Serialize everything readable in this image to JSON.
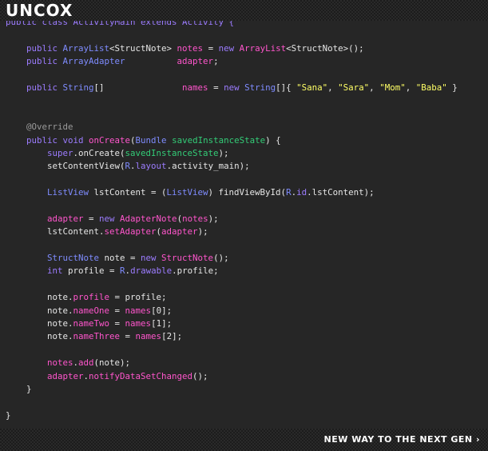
{
  "header": {
    "logo": "UNCOX"
  },
  "footer": {
    "tagline": "NEW WAY TO THE NEXT GEN ›"
  },
  "theme": {
    "plain": "#e6e6e6",
    "keyword": "#9c7cff",
    "type": "#7f8cff",
    "method": "#ff55cc",
    "variable": "#ff55cc",
    "string": "#ffff66",
    "param": "#33cc77",
    "annotation": "#9a9a9a",
    "field": "#9c7cff"
  },
  "code_lines": [
    [
      {
        "t": "public class ActivityMain extends Activity {",
        "c": "keyword"
      }
    ],
    [],
    [
      {
        "t": "    public ",
        "c": "keyword"
      },
      {
        "t": "ArrayList",
        "c": "type"
      },
      {
        "t": "<StructNote> ",
        "c": "plain"
      },
      {
        "t": "notes",
        "c": "variable"
      },
      {
        "t": " = ",
        "c": "plain"
      },
      {
        "t": "new ",
        "c": "keyword"
      },
      {
        "t": "ArrayList",
        "c": "method"
      },
      {
        "t": "<StructNote>();",
        "c": "plain"
      }
    ],
    [
      {
        "t": "    public ",
        "c": "keyword"
      },
      {
        "t": "ArrayAdapter",
        "c": "type"
      },
      {
        "t": "          ",
        "c": "plain"
      },
      {
        "t": "adapter",
        "c": "variable"
      },
      {
        "t": ";",
        "c": "plain"
      }
    ],
    [],
    [
      {
        "t": "    public ",
        "c": "keyword"
      },
      {
        "t": "String",
        "c": "type"
      },
      {
        "t": "[]               ",
        "c": "plain"
      },
      {
        "t": "names",
        "c": "variable"
      },
      {
        "t": " = ",
        "c": "plain"
      },
      {
        "t": "new ",
        "c": "keyword"
      },
      {
        "t": "String",
        "c": "type"
      },
      {
        "t": "[]{ ",
        "c": "plain"
      },
      {
        "t": "\"Sana\"",
        "c": "string"
      },
      {
        "t": ", ",
        "c": "plain"
      },
      {
        "t": "\"Sara\"",
        "c": "string"
      },
      {
        "t": ", ",
        "c": "plain"
      },
      {
        "t": "\"Mom\"",
        "c": "string"
      },
      {
        "t": ", ",
        "c": "plain"
      },
      {
        "t": "\"Baba\"",
        "c": "string"
      },
      {
        "t": " }",
        "c": "plain"
      }
    ],
    [],
    [],
    [
      {
        "t": "    @Override",
        "c": "annotation"
      }
    ],
    [
      {
        "t": "    public void ",
        "c": "keyword"
      },
      {
        "t": "onCreate",
        "c": "method"
      },
      {
        "t": "(",
        "c": "plain"
      },
      {
        "t": "Bundle ",
        "c": "type"
      },
      {
        "t": "savedInstanceState",
        "c": "param"
      },
      {
        "t": ") {",
        "c": "plain"
      }
    ],
    [
      {
        "t": "        super",
        "c": "keyword"
      },
      {
        "t": ".onCreate(",
        "c": "plain"
      },
      {
        "t": "savedInstanceState",
        "c": "param"
      },
      {
        "t": ");",
        "c": "plain"
      }
    ],
    [
      {
        "t": "        setContentView(",
        "c": "plain"
      },
      {
        "t": "R",
        "c": "type"
      },
      {
        "t": ".",
        "c": "plain"
      },
      {
        "t": "layout",
        "c": "field"
      },
      {
        "t": ".activity_main);",
        "c": "plain"
      }
    ],
    [],
    [
      {
        "t": "        ListView ",
        "c": "type"
      },
      {
        "t": "lstContent = (",
        "c": "plain"
      },
      {
        "t": "ListView",
        "c": "type"
      },
      {
        "t": ") findViewById(",
        "c": "plain"
      },
      {
        "t": "R",
        "c": "type"
      },
      {
        "t": ".",
        "c": "plain"
      },
      {
        "t": "id",
        "c": "field"
      },
      {
        "t": ".lstContent);",
        "c": "plain"
      }
    ],
    [],
    [
      {
        "t": "        adapter",
        "c": "variable"
      },
      {
        "t": " = ",
        "c": "plain"
      },
      {
        "t": "new ",
        "c": "keyword"
      },
      {
        "t": "AdapterNote",
        "c": "method"
      },
      {
        "t": "(",
        "c": "plain"
      },
      {
        "t": "notes",
        "c": "variable"
      },
      {
        "t": ");",
        "c": "plain"
      }
    ],
    [
      {
        "t": "        lstContent.",
        "c": "plain"
      },
      {
        "t": "setAdapter",
        "c": "method"
      },
      {
        "t": "(",
        "c": "plain"
      },
      {
        "t": "adapter",
        "c": "variable"
      },
      {
        "t": ");",
        "c": "plain"
      }
    ],
    [],
    [
      {
        "t": "        StructNote ",
        "c": "type"
      },
      {
        "t": "note = ",
        "c": "plain"
      },
      {
        "t": "new ",
        "c": "keyword"
      },
      {
        "t": "StructNote",
        "c": "method"
      },
      {
        "t": "();",
        "c": "plain"
      }
    ],
    [
      {
        "t": "        int ",
        "c": "keyword"
      },
      {
        "t": "profile = ",
        "c": "plain"
      },
      {
        "t": "R",
        "c": "type"
      },
      {
        "t": ".",
        "c": "plain"
      },
      {
        "t": "drawable",
        "c": "field"
      },
      {
        "t": ".profile;",
        "c": "plain"
      }
    ],
    [],
    [
      {
        "t": "        note.",
        "c": "plain"
      },
      {
        "t": "profile",
        "c": "variable"
      },
      {
        "t": " = profile;",
        "c": "plain"
      }
    ],
    [
      {
        "t": "        note.",
        "c": "plain"
      },
      {
        "t": "nameOne",
        "c": "variable"
      },
      {
        "t": " = ",
        "c": "plain"
      },
      {
        "t": "names",
        "c": "variable"
      },
      {
        "t": "[0];",
        "c": "plain"
      }
    ],
    [
      {
        "t": "        note.",
        "c": "plain"
      },
      {
        "t": "nameTwo",
        "c": "variable"
      },
      {
        "t": " = ",
        "c": "plain"
      },
      {
        "t": "names",
        "c": "variable"
      },
      {
        "t": "[1];",
        "c": "plain"
      }
    ],
    [
      {
        "t": "        note.",
        "c": "plain"
      },
      {
        "t": "nameThree",
        "c": "variable"
      },
      {
        "t": " = ",
        "c": "plain"
      },
      {
        "t": "names",
        "c": "variable"
      },
      {
        "t": "[2];",
        "c": "plain"
      }
    ],
    [],
    [
      {
        "t": "        notes",
        "c": "variable"
      },
      {
        "t": ".",
        "c": "plain"
      },
      {
        "t": "add",
        "c": "method"
      },
      {
        "t": "(note);",
        "c": "plain"
      }
    ],
    [
      {
        "t": "        adapter",
        "c": "variable"
      },
      {
        "t": ".",
        "c": "plain"
      },
      {
        "t": "notifyDataSetChanged",
        "c": "method"
      },
      {
        "t": "();",
        "c": "plain"
      }
    ],
    [
      {
        "t": "    }",
        "c": "plain"
      }
    ],
    [],
    [
      {
        "t": "}",
        "c": "plain"
      }
    ]
  ]
}
